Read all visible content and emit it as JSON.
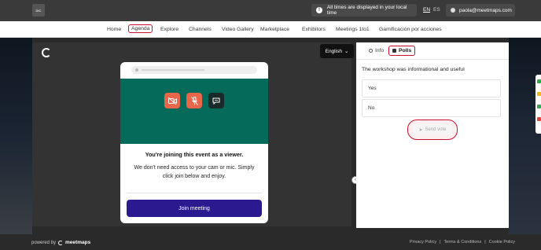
{
  "topbar": {
    "logo_text": "DIC",
    "timezone_text": "All times are displayed in your local time",
    "lang_en": "EN",
    "lang_es": "ES",
    "user_email": "paola@meetmaps.com"
  },
  "nav": {
    "items": [
      "Home",
      "Agenda",
      "Explore",
      "Channels",
      "Video Gallery",
      "Marketplace",
      "Exhibitors",
      "Meetings 1to1",
      "Gamificación por acciones"
    ],
    "active": "Agenda"
  },
  "stage": {
    "language": "English",
    "viewer_title": "You're joining this event as a viewer.",
    "viewer_desc": "We don't need access to your cam or mic. Simply click join below and enjoy.",
    "join_label": "Join meeting"
  },
  "panel": {
    "tab_info": "Info",
    "tab_polls": "Polls",
    "question": "The workshop was informational and useful",
    "options": [
      "Yes",
      "No"
    ],
    "send_label": "Send vote"
  },
  "footer": {
    "powered_by": "powered by",
    "brand": "meetmaps",
    "links": [
      "Privacy Policy",
      "|",
      "Terms & Conditions",
      "|",
      "Cookie Policy"
    ]
  },
  "colors": {
    "accent_red": "#c8102e",
    "join_button": "#2b1a8f",
    "video_green": "#046a5a",
    "media_button": "#e8664a"
  }
}
